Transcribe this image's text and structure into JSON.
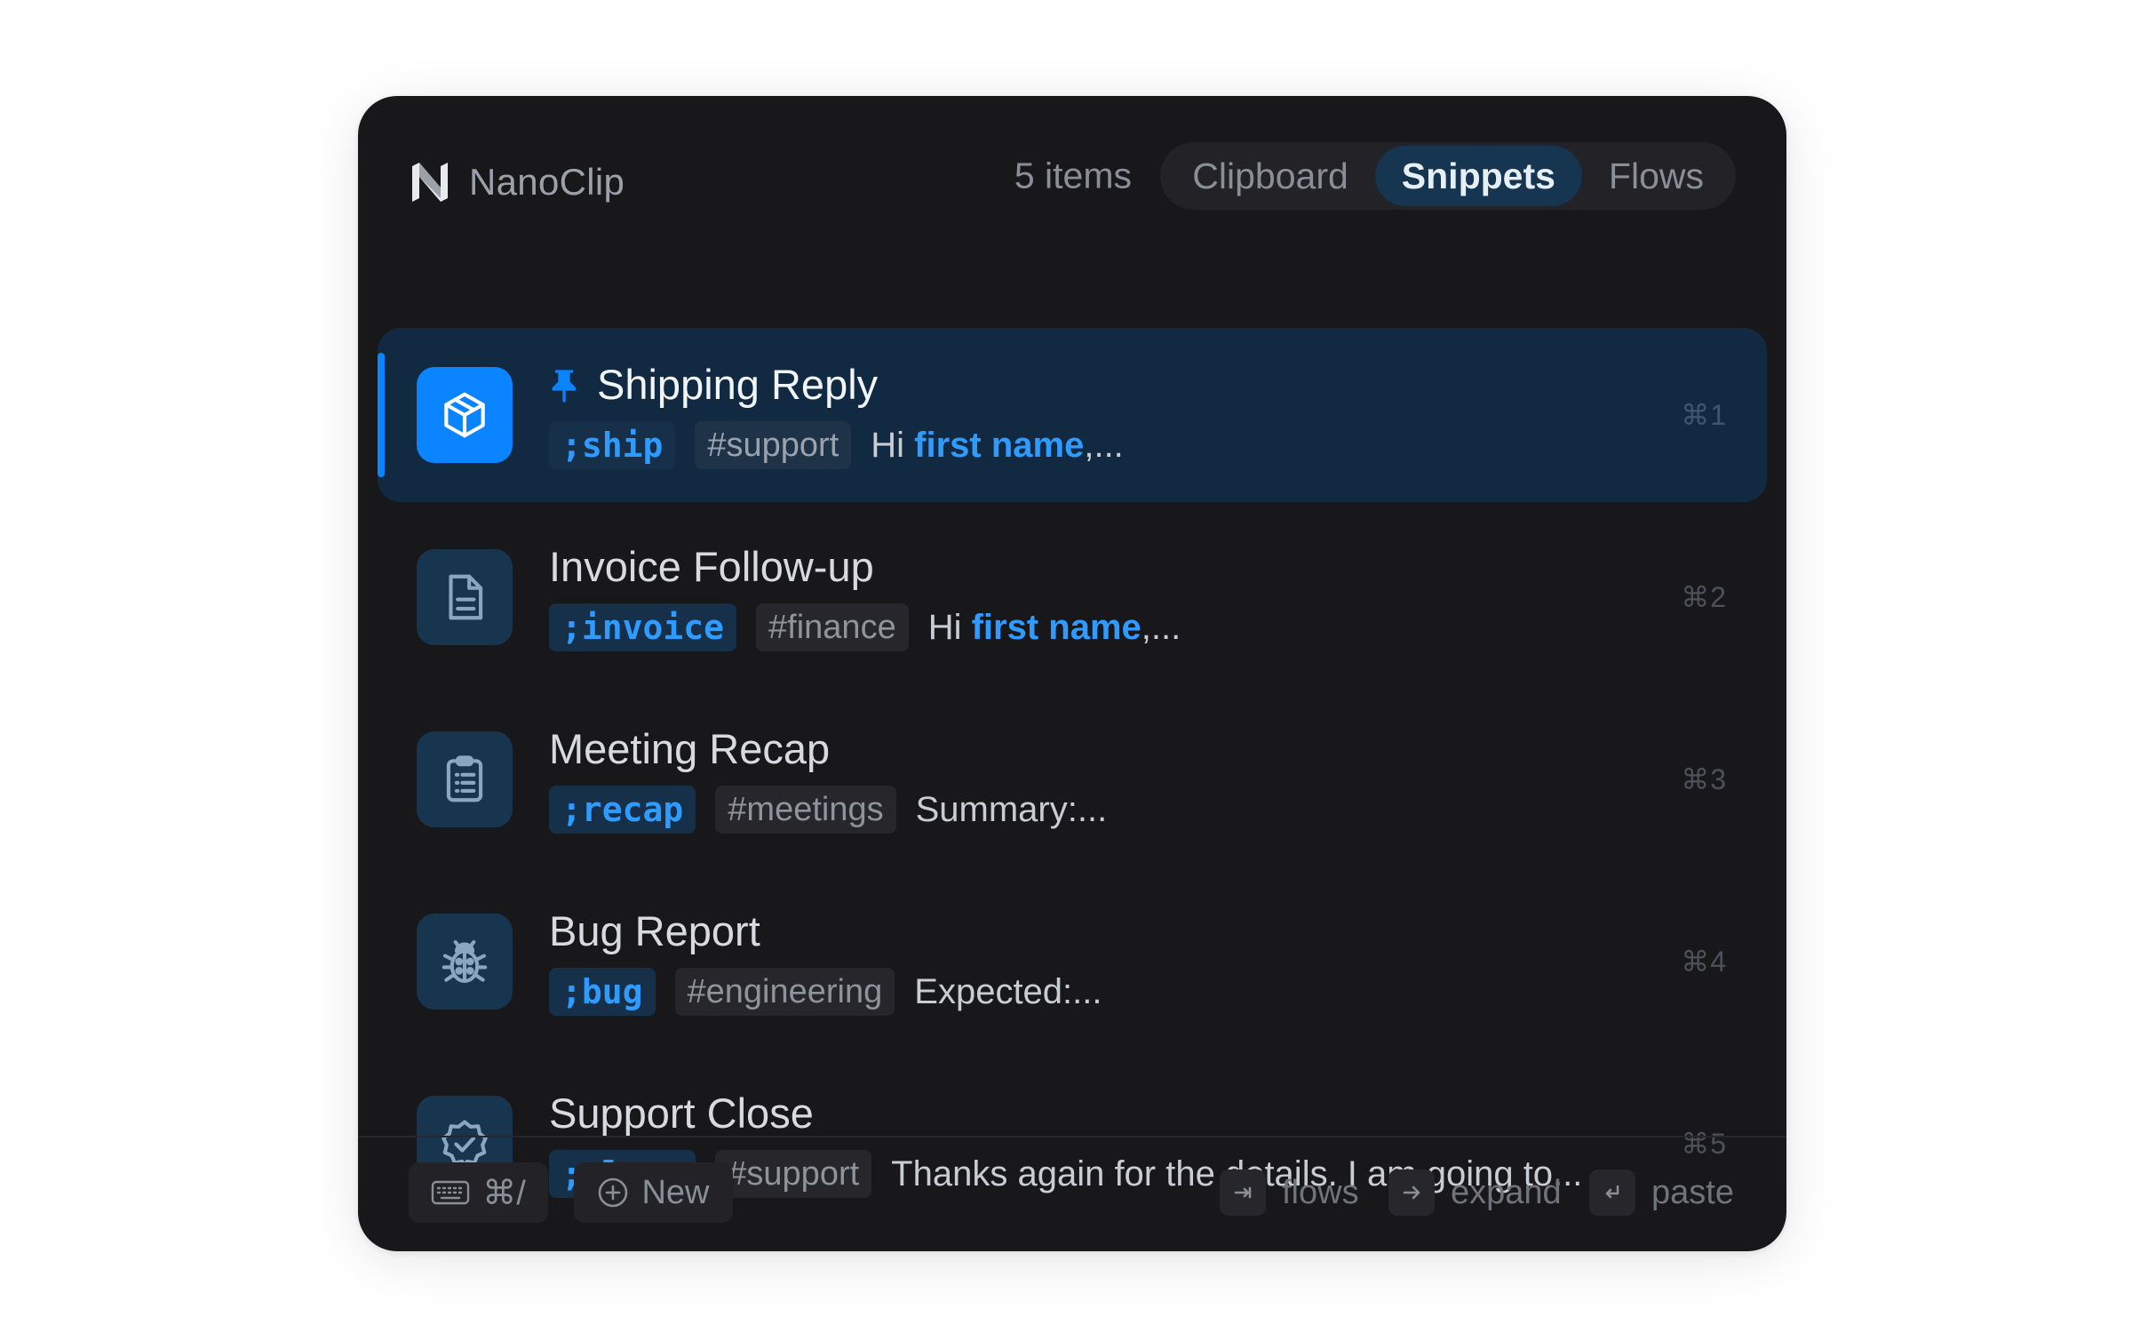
{
  "app": {
    "name": "NanoClip",
    "logo_icon": "nanoclip-logo-icon",
    "accent_color": "#0a84ff"
  },
  "header": {
    "item_count": "5 items",
    "tabs": [
      {
        "label": "Clipboard",
        "active": false
      },
      {
        "label": "Snippets",
        "active": true
      },
      {
        "label": "Flows",
        "active": false
      }
    ]
  },
  "snippets": [
    {
      "title": "Shipping Reply",
      "pinned": true,
      "selected": true,
      "icon": "package-box-icon",
      "trigger": ";ship",
      "tag": "#support",
      "preview_prefix": "Hi ",
      "preview_var": "first name",
      "preview_suffix": ",...",
      "shortcut": "⌘1"
    },
    {
      "title": "Invoice Follow-up",
      "pinned": false,
      "selected": false,
      "icon": "document-icon",
      "trigger": ";invoice",
      "tag": "#finance",
      "preview_prefix": "Hi ",
      "preview_var": "first name",
      "preview_suffix": ",...",
      "shortcut": "⌘2"
    },
    {
      "title": "Meeting Recap",
      "pinned": false,
      "selected": false,
      "icon": "clipboard-list-icon",
      "trigger": ";recap",
      "tag": "#meetings",
      "preview_prefix": "Summary:...",
      "preview_var": "",
      "preview_suffix": "",
      "shortcut": "⌘3"
    },
    {
      "title": "Bug Report",
      "pinned": false,
      "selected": false,
      "icon": "bug-icon",
      "trigger": ";bug",
      "tag": "#engineering",
      "preview_prefix": "Expected:...",
      "preview_var": "",
      "preview_suffix": "",
      "shortcut": "⌘4"
    },
    {
      "title": "Support Close",
      "pinned": false,
      "selected": false,
      "icon": "verified-badge-icon",
      "trigger": ";close",
      "tag": "#support",
      "preview_prefix": "Thanks again for the details. I am going to...",
      "preview_var": "",
      "preview_suffix": "",
      "shortcut": "⌘5"
    }
  ],
  "footer": {
    "keyboard_shortcut_label": "⌘/",
    "keyboard_icon": "keyboard-icon",
    "new_label": "New",
    "new_icon": "plus-circle-icon",
    "hints": [
      {
        "key_icon": "tab-key-icon",
        "label": "flows"
      },
      {
        "key_icon": "arrow-right-icon",
        "label": "expand"
      },
      {
        "key_icon": "return-key-icon",
        "label": "paste"
      }
    ]
  }
}
